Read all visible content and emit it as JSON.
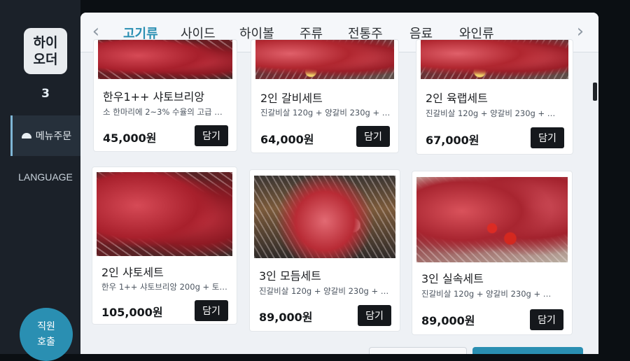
{
  "sidebar": {
    "logo_line1": "하이",
    "logo_line2": "오더",
    "table_number": "3",
    "menu_order_label": "메뉴주문",
    "language_label": "LANGUAGE",
    "call_staff_line1": "직원",
    "call_staff_line2": "호출"
  },
  "tabs": [
    {
      "label": "고기류",
      "active": true
    },
    {
      "label": "사이드"
    },
    {
      "label": "하이볼"
    },
    {
      "label": "주류"
    },
    {
      "label": "전통주"
    },
    {
      "label": "음료"
    },
    {
      "label": "와인류"
    }
  ],
  "icons": {
    "prev": "chevron-left-icon",
    "next": "chevron-right-icon",
    "menu_order": "bell-icon"
  },
  "colors": {
    "accent": "#2a8fb2",
    "sidebar_bg": "#1b2129",
    "button_bg": "#15181c"
  },
  "add_button_label": "담기",
  "products": [
    {
      "name": "한우1++ 샤토브리앙",
      "desc": "소 한마리에 2~3% 수율의 고급 …",
      "price": "45,000원"
    },
    {
      "name": "2인 갈비세트",
      "desc": "진갈비살 120g + 양갈비 230g + …",
      "price": "64,000원"
    },
    {
      "name": "2인 육랩세트",
      "desc": "진갈비살 120g + 양갈비 230g + …",
      "price": "67,000원"
    },
    {
      "name": "2인 샤토세트",
      "desc": "한우 1++ 샤토브리앙 200g + 토…",
      "price": "105,000원"
    },
    {
      "name": "3인 모듬세트",
      "desc": "진갈비살 120g + 양갈비 230g + …",
      "price": "89,000원"
    },
    {
      "name": "3인 실속세트",
      "desc": "진갈비살 120g + 양갈비 230g + …",
      "price": "89,000원"
    }
  ]
}
